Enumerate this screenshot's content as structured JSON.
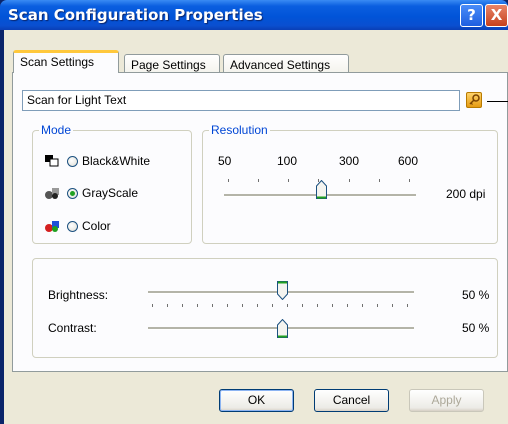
{
  "window": {
    "title": "Scan Configuration Properties",
    "help_glyph": "?",
    "close_glyph": "X"
  },
  "tabs": [
    {
      "label": "Scan Settings",
      "active": true
    },
    {
      "label": "Page Settings",
      "active": false
    },
    {
      "label": "Advanced Settings",
      "active": false
    }
  ],
  "preset": {
    "value": "Scan for Light Text",
    "key_icon": "key-icon"
  },
  "mode": {
    "legend": "Mode",
    "options": [
      {
        "label": "Black&White",
        "icon": "black-white-mode-icon",
        "checked": false
      },
      {
        "label": "GrayScale",
        "icon": "grayscale-mode-icon",
        "checked": true
      },
      {
        "label": "Color",
        "icon": "color-mode-icon",
        "checked": false
      }
    ]
  },
  "resolution": {
    "legend": "Resolution",
    "ticks": [
      "50",
      "100",
      "300",
      "600"
    ],
    "value_label": "200 dpi"
  },
  "adjustments": {
    "brightness_label": "Brightness:",
    "brightness_value": "50 %",
    "brightness_level": 0.5,
    "contrast_label": "Contrast:",
    "contrast_value": "50 %",
    "contrast_level": 0.5
  },
  "buttons": {
    "ok": "OK",
    "cancel": "Cancel",
    "apply": "Apply"
  },
  "colors": {
    "title_bar": "#0054e3",
    "dialog_bg": "#ece9d8",
    "group_legend": "#0046d5",
    "active_tab_accent": "#ffc83c"
  }
}
